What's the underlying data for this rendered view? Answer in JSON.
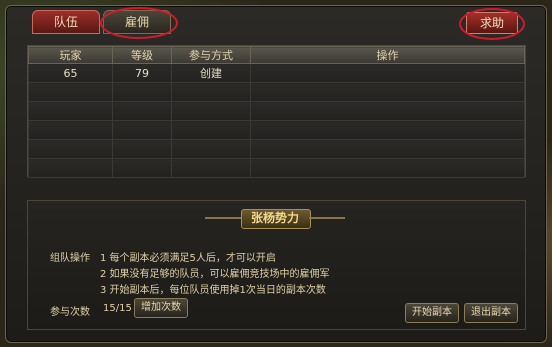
{
  "tabs": {
    "team": "队伍",
    "mercenary": "雇佣"
  },
  "help_button": "求助",
  "table": {
    "headers": [
      "玩家",
      "等级",
      "参与方式",
      "操作"
    ],
    "rows": [
      [
        "65",
        "79",
        "创建",
        ""
      ],
      [
        "",
        "",
        "",
        ""
      ],
      [
        "",
        "",
        "",
        ""
      ],
      [
        "",
        "",
        "",
        ""
      ],
      [
        "",
        "",
        "",
        ""
      ],
      [
        "",
        "",
        "",
        ""
      ]
    ]
  },
  "banner_title": "张杨势力",
  "rules": {
    "label": "组队操作",
    "lines": [
      "1 每个副本必须满足5人后，才可以开启",
      "2 如果没有足够的队员，可以雇佣竞技场中的雇佣军",
      "3 开始副本后，每位队员使用掉1次当日的副本次数"
    ]
  },
  "attempts": {
    "label": "参与次数",
    "value": "15/15",
    "add_button": "增加次数"
  },
  "buttons": {
    "start": "开始副本",
    "exit": "退出副本"
  },
  "colors": {
    "highlight_circle": "#d11a2a",
    "active_tab": "#9a2f2a"
  }
}
